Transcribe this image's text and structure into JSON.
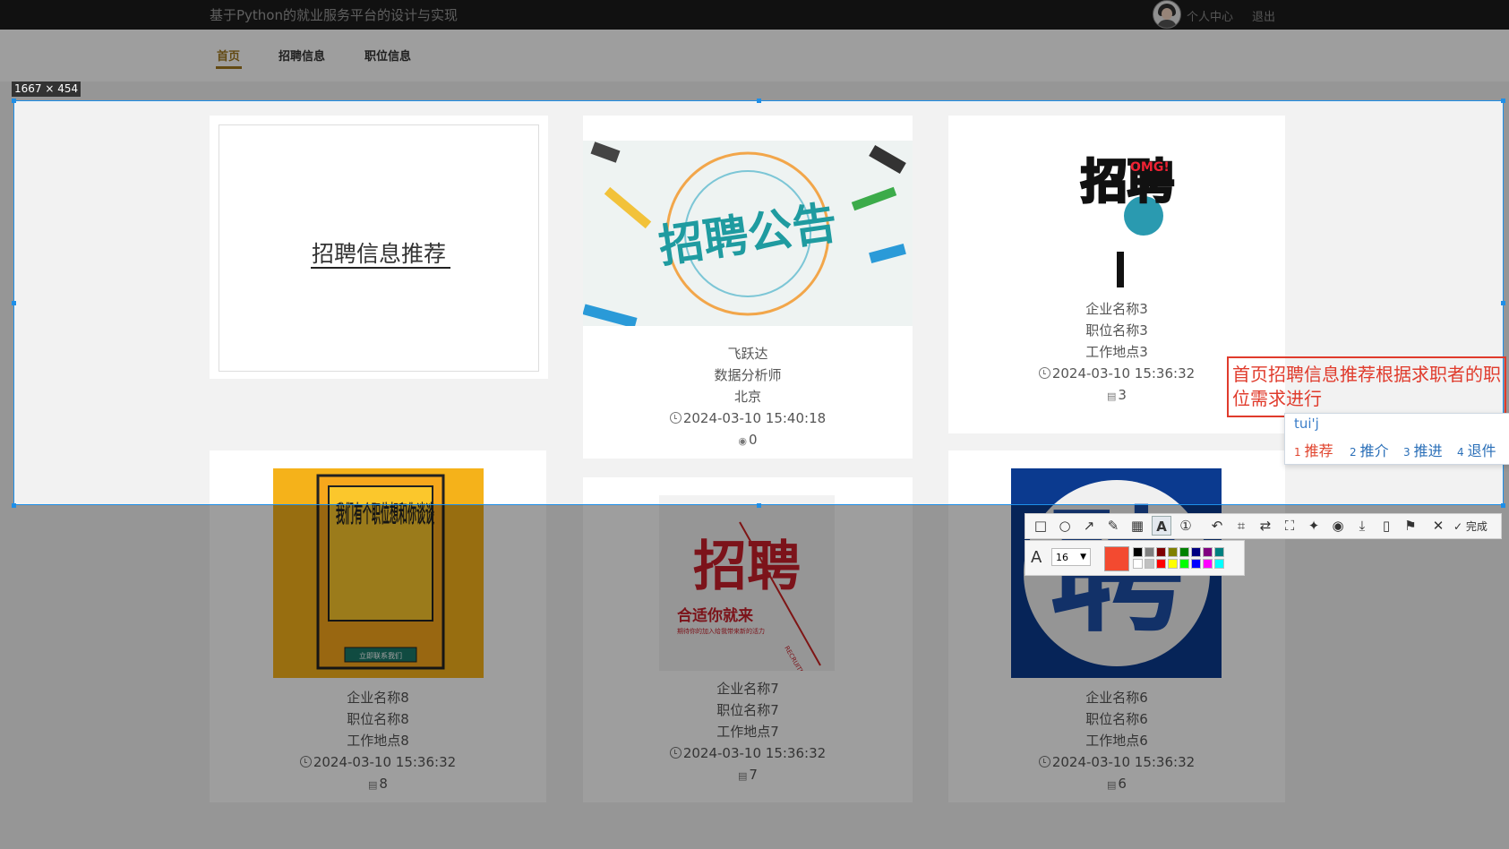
{
  "site": {
    "title": "基于Python的就业服务平台的设计与实现",
    "user_center": "个人中心",
    "logout": "退出"
  },
  "nav": {
    "items": [
      "首页",
      "招聘信息",
      "职位信息"
    ],
    "active": "首页"
  },
  "title_card": {
    "text": "招聘信息推荐"
  },
  "cards": [
    {
      "poster": "招聘公告",
      "company": "飞跃达",
      "position": "数据分析师",
      "location": "北京",
      "time": "2024-03-10 15:40:18",
      "count": "0",
      "count_icon": "eye-icon"
    },
    {
      "poster": "招聘",
      "poster_extra": "OMG!",
      "company": "企业名称3",
      "position": "职位名称3",
      "location": "工作地点3",
      "time": "2024-03-10 15:36:32",
      "count": "3",
      "count_icon": "doc-icon"
    },
    {
      "poster": "我们有个职位想和你谈谈",
      "poster_sub": "立即联系我们",
      "company": "企业名称8",
      "position": "职位名称8",
      "location": "工作地点8",
      "time": "2024-03-10 15:36:32",
      "count": "8",
      "count_icon": "doc-icon"
    },
    {
      "poster": "招聘",
      "poster_sub": "合适你就来",
      "poster_small": "期待你的加入给我带来新的活力",
      "poster_en": "RECRUITMENT",
      "company": "企业名称7",
      "position": "职位名称7",
      "location": "工作地点7",
      "time": "2024-03-10 15:36:32",
      "count": "7",
      "count_icon": "doc-icon"
    },
    {
      "poster": "聘",
      "company": "企业名称6",
      "position": "职位名称6",
      "location": "工作地点6",
      "time": "2024-03-10 15:36:32",
      "count": "6",
      "count_icon": "doc-icon"
    }
  ],
  "screenshot_tool": {
    "size_label": "1667 × 454",
    "annotation_text": "首页招聘信息推荐根据求职者的职位需求进行",
    "ime": {
      "input": "tui'j",
      "candidates": [
        {
          "n": "1",
          "text": "推荐"
        },
        {
          "n": "2",
          "text": "推介"
        },
        {
          "n": "3",
          "text": "推进"
        },
        {
          "n": "4",
          "text": "退件"
        }
      ]
    },
    "done_label": "完成",
    "font_size": "16",
    "current_color": "#f34a30",
    "palette": [
      "#000000",
      "#808080",
      "#800000",
      "#808000",
      "#008000",
      "#000080",
      "#800080",
      "#008080",
      "#ffffff",
      "#c0c0c0",
      "#ff0000",
      "#ffff00",
      "#00ff00",
      "#0000ff",
      "#ff00ff",
      "#00ffff"
    ],
    "tools": [
      "rectangle-icon",
      "ellipse-icon",
      "arrow-icon",
      "pencil-icon",
      "mosaic-icon",
      "text-icon",
      "serial-number-icon",
      "undo-icon",
      "ocr-icon",
      "translate-icon",
      "long-screenshot-icon",
      "pin-icon",
      "record-icon",
      "download-icon",
      "copy-icon",
      "bookmark-icon",
      "close-icon"
    ]
  }
}
